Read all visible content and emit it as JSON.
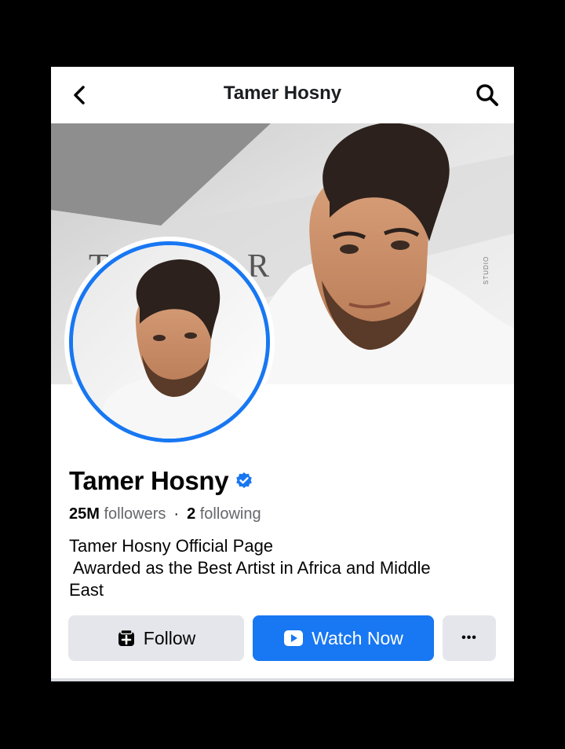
{
  "header": {
    "title": "Tamer Hosny",
    "back_icon": "chevron-left-icon",
    "search_icon": "search-icon"
  },
  "cover": {
    "watermark": "STUDIO",
    "bg_letters": [
      "T",
      "R"
    ]
  },
  "profile": {
    "name": "Tamer Hosny",
    "verified_icon": "verified-badge-icon",
    "followers_count": "25M",
    "followers_label": "followers",
    "following_count": "2",
    "following_label": "following",
    "bio_lines": [
      "Tamer Hosny Official Page",
      " Awarded as the Best Artist in Africa and Middle",
      "East"
    ]
  },
  "actions": {
    "follow_label": "Follow",
    "follow_icon": "follow-page-icon",
    "watch_label": "Watch Now",
    "watch_icon": "play-icon",
    "more_label": "•••"
  },
  "colors": {
    "accent": "#1877f2",
    "button_gray": "#e4e6eb",
    "text_primary": "#050505",
    "text_secondary": "#65676b"
  }
}
